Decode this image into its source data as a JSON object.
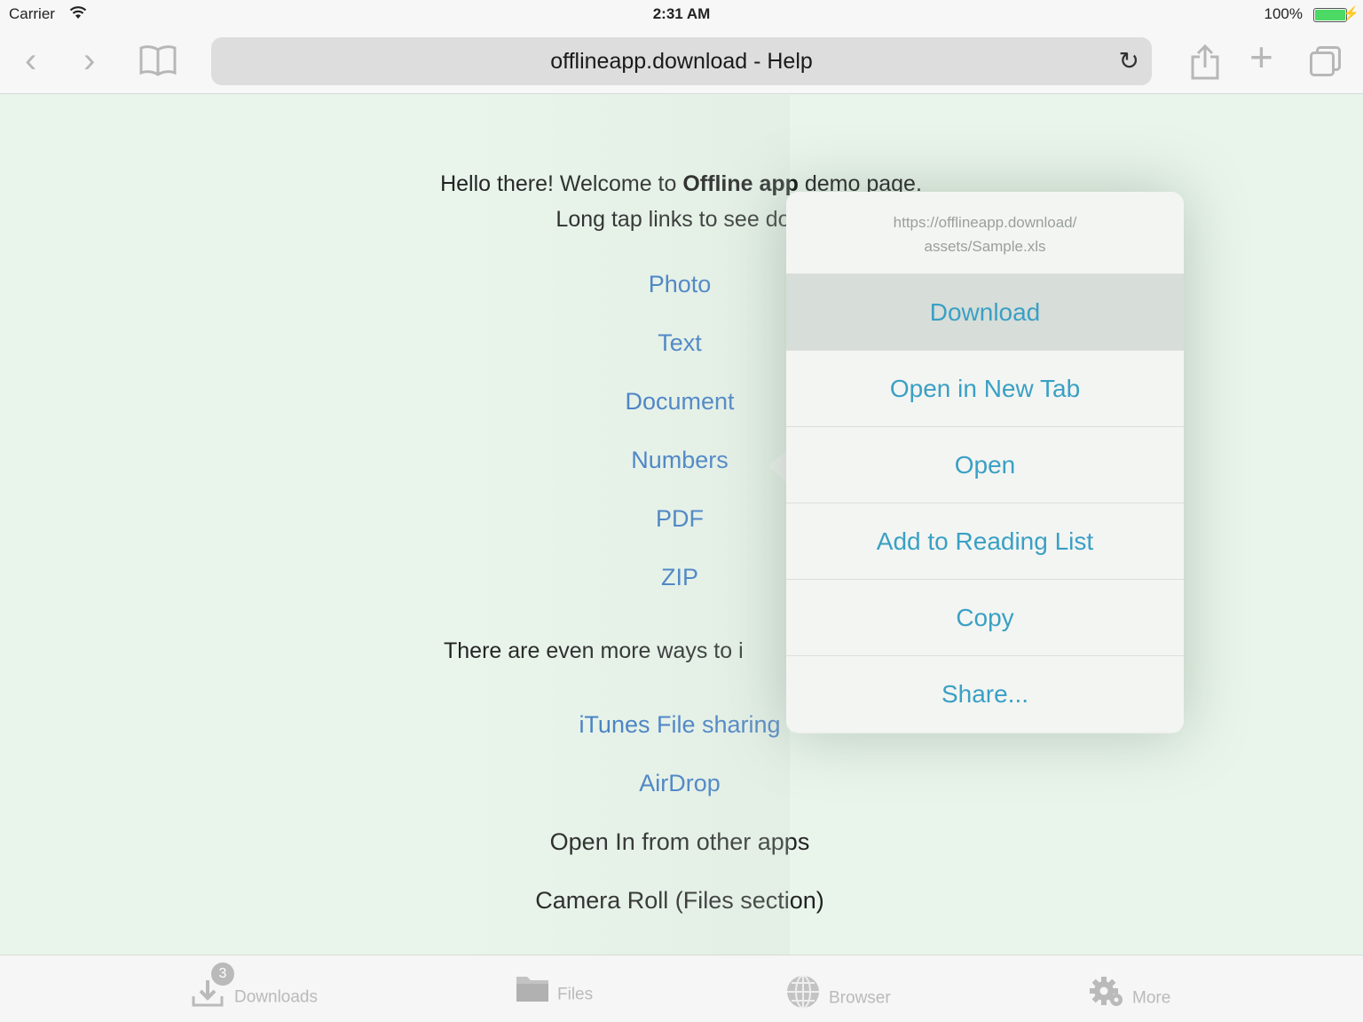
{
  "status_bar": {
    "carrier": "Carrier",
    "time": "2:31 AM",
    "battery": "100%",
    "battery_level": 1.0
  },
  "toolbar": {
    "address": "offlineapp.download - Help"
  },
  "page": {
    "intro_prefix": "Hello there! Welcome to ",
    "intro_bold": "Offline app",
    "intro_suffix": " demo page. Long tap links to see dow",
    "links": [
      "Photo",
      "Text",
      "Document",
      "Numbers",
      "PDF",
      "ZIP"
    ],
    "more_ways": "There are even more ways to i",
    "import_links": [
      "iTunes File sharing",
      "AirDrop"
    ],
    "import_plain": [
      "Open In from other apps",
      "Camera Roll (Files section)"
    ]
  },
  "popover": {
    "url_line1": "https://offlineapp.download/",
    "url_line2": "assets/Sample.xls",
    "items": [
      "Download",
      "Open in New Tab",
      "Open",
      "Add to Reading List",
      "Copy",
      "Share..."
    ]
  },
  "tabbar": {
    "downloads": "Downloads",
    "downloads_badge": "3",
    "files": "Files",
    "browser": "Browser",
    "more": "More"
  },
  "colors": {
    "link_blue": "#3a78c4",
    "popover_teal": "#3aa0c4",
    "page_bg": "#e9f5eb"
  }
}
